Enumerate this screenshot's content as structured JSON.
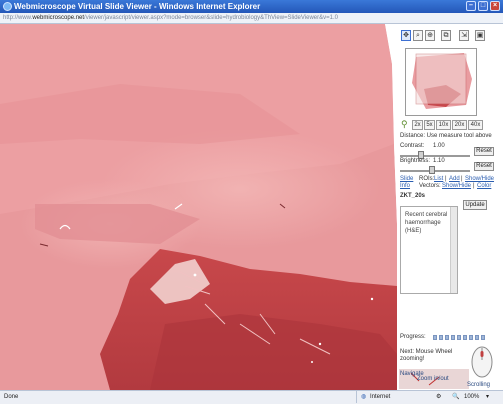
{
  "window": {
    "title": "Webmicroscope Virtual Slide Viewer - Windows Internet Explorer",
    "address_host": "webmicroscope.net",
    "address_path": "/viewer/javascript/viewer.aspx?mode=browser&slide=hydrobiology&ThView=SlideViewer&v=1.0",
    "address_prefix": "http://www."
  },
  "tools": [
    {
      "name": "pan-tool",
      "glyph": "✥"
    },
    {
      "name": "zoom-tool",
      "glyph": "⌕"
    },
    {
      "name": "measure-tool",
      "glyph": "⊕"
    },
    {
      "name": "view-tool",
      "glyph": "⧉"
    },
    {
      "name": "fit-tool",
      "glyph": "⇲"
    },
    {
      "name": "print-tool",
      "glyph": "▣"
    }
  ],
  "zoom": {
    "levels": [
      "2x",
      "5x",
      "10x",
      "20x",
      "40x"
    ]
  },
  "distance_label": "Distance: Use measure tool above",
  "contrast": {
    "label": "Contrast:",
    "value": "1.00",
    "reset_label": "Reset",
    "level": 0.3
  },
  "brightness": {
    "label": "Brightness:",
    "value": "1.10",
    "reset_label": "Reset",
    "level": 0.45
  },
  "links": {
    "slide_info": [
      "Slide",
      "Info"
    ],
    "rois": "ROIs:",
    "list": "List",
    "add": "Add",
    "show_hide": "Show/Hide",
    "vectors": "Vectors:",
    "vec_show_hide": "Show/Hide",
    "color": "Color"
  },
  "annotation": {
    "name": "ZKT_20s",
    "text": "Recent cerebral haemorrhage (H&E)",
    "update_label": "Update"
  },
  "progress": {
    "label": "Progress:",
    "segments": 9
  },
  "help": {
    "next": "Next: Mouse Wheel zooming!",
    "navigate": "Navigate",
    "zoom_in_out": "Zoom in/out",
    "scrolling": "Scrolling"
  },
  "status": {
    "left": "Done",
    "zone": "Internet",
    "zoom": "100%"
  },
  "colors": {
    "titlebar": "#2a5fc6",
    "tissue": "#e8989c",
    "hemorrhage": "#b8383e"
  }
}
